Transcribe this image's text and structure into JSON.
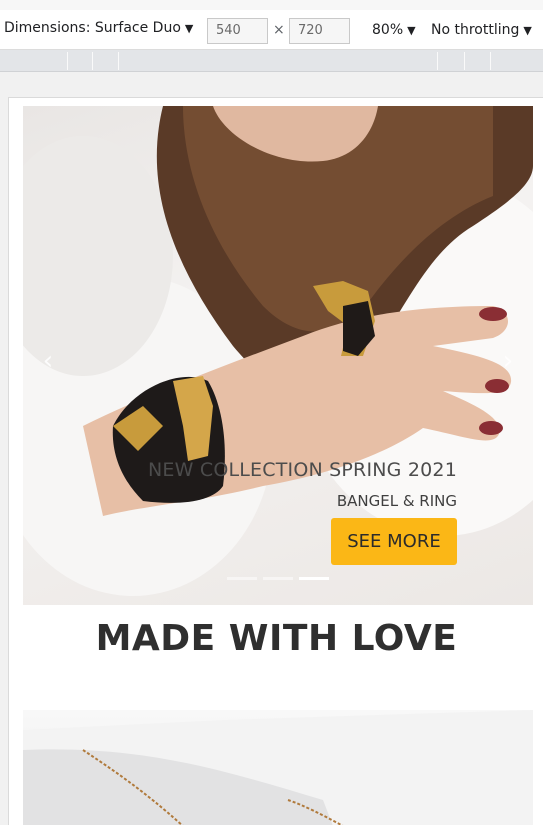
{
  "toolbar": {
    "dimensions_label": "Dimensions: Surface Duo",
    "width_value": "540",
    "height_value": "720",
    "times": "×",
    "zoom": "80%",
    "throttling": "No throttling",
    "caret": "▼"
  },
  "hero": {
    "prev_arrow": "‹",
    "next_arrow": "›",
    "caption_title": "NEW COLLECTION SPRING 2021",
    "caption_subtitle": "BANGEL & RING",
    "button_label": "SEE MORE",
    "active_slide": 3,
    "slide_count": 3
  },
  "headline": "MADE WITH LOVE",
  "colors": {
    "button_bg": "#fbb716",
    "text_dark": "#2f2f2f"
  }
}
